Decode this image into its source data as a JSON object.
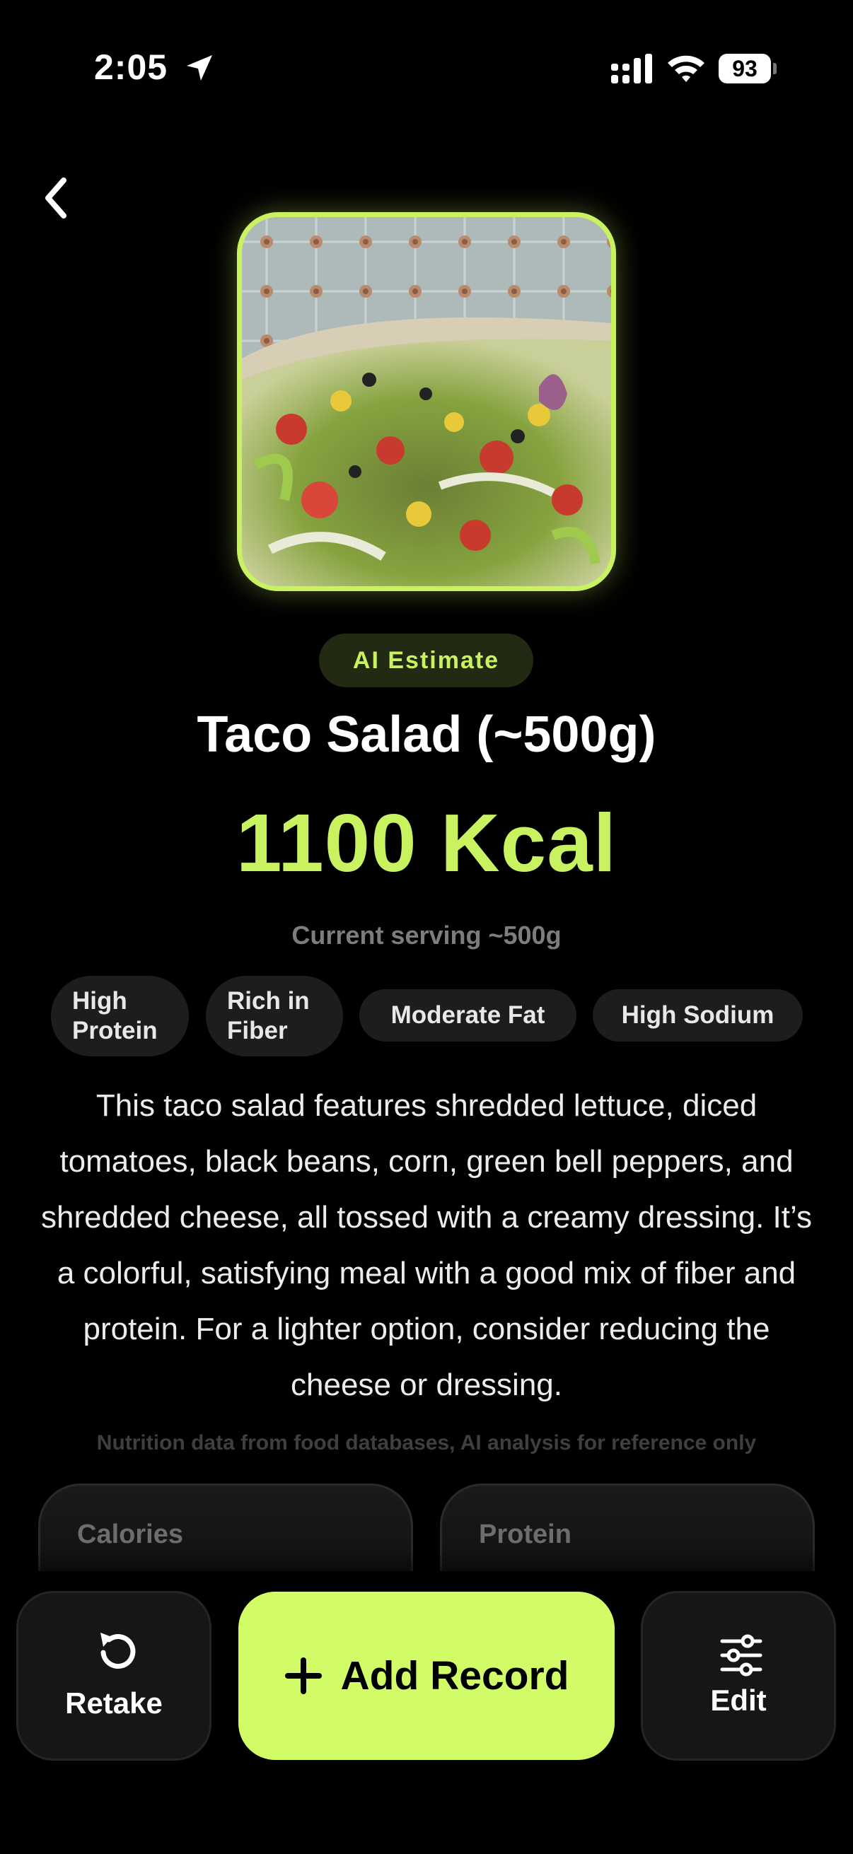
{
  "status_bar": {
    "time": "2:05",
    "battery": "93"
  },
  "food": {
    "badge": "AI Estimate",
    "title": "Taco Salad (~500g)",
    "calories": "1100 Kcal",
    "serving": "Current serving ~500g",
    "tags": [
      "High\nProtein",
      "Rich in\nFiber",
      "Moderate Fat",
      "High Sodium"
    ],
    "description": "This taco salad features shredded lettuce, diced tomatoes, black beans, corn, green bell peppers, and shredded cheese, all tossed with a creamy dressing. It’s a colorful, satisfying meal with a good mix of fiber and protein. For a lighter option, consider reducing the cheese or dressing.",
    "disclaimer": "Nutrition data from food databases, AI analysis for reference only"
  },
  "nutrients": {
    "calories_label": "Calories",
    "protein_label": "Protein"
  },
  "actions": {
    "retake": "Retake",
    "add": "Add Record",
    "edit": "Edit"
  },
  "icons": {
    "back": "chevron-left-icon",
    "retake": "rotate-ccw-icon",
    "add": "plus-icon",
    "edit": "sliders-icon"
  },
  "colors": {
    "accent": "#c9f261",
    "button_accent": "#d1fc67",
    "background": "#000000"
  }
}
